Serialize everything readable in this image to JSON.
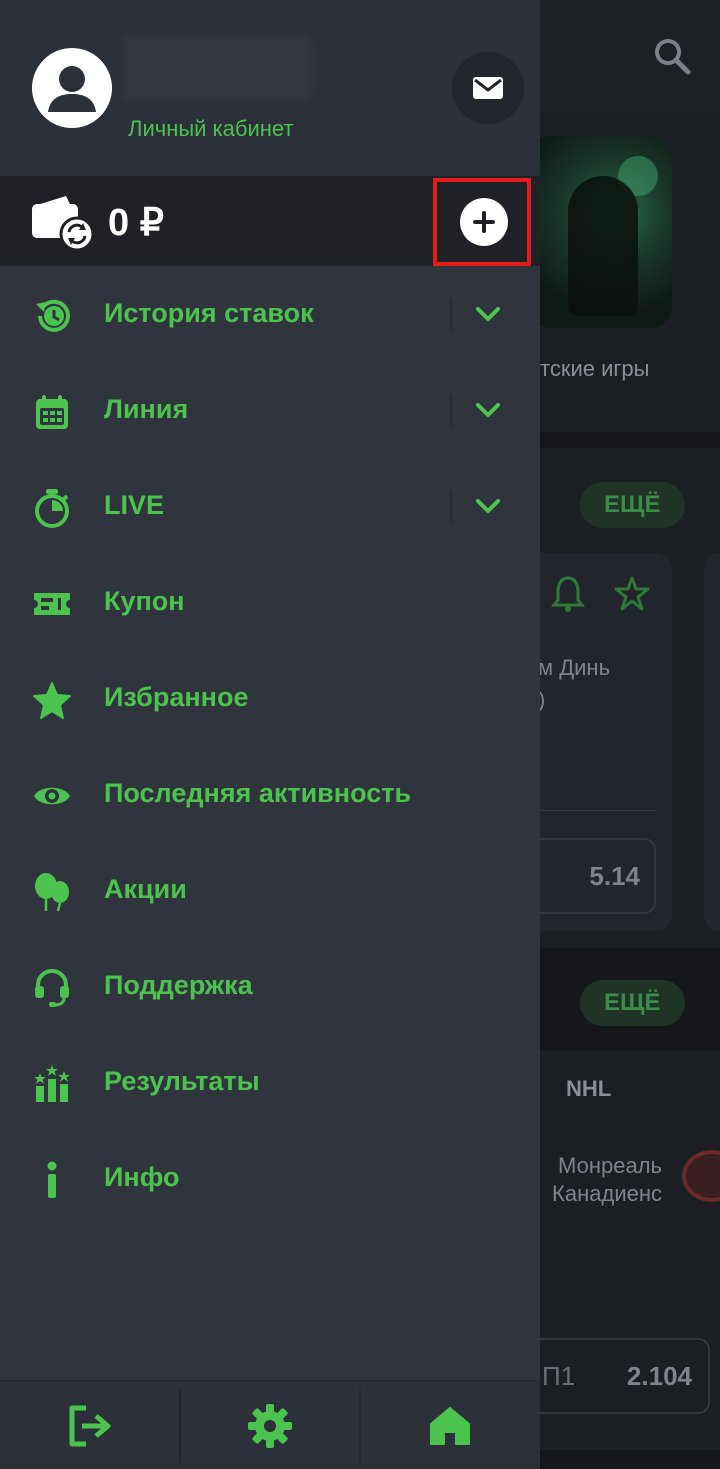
{
  "header": {
    "cabinet_label": "Личный кабинет",
    "avatar_icon": "user-avatar-icon",
    "mail_icon": "envelope-icon"
  },
  "balance": {
    "amount": "0 ₽",
    "wallet_icon": "wallet-refresh-icon",
    "add_icon": "plus-circle-icon"
  },
  "menu": {
    "items": [
      {
        "label": "История ставок",
        "icon": "history-icon",
        "expandable": true
      },
      {
        "label": "Линия",
        "icon": "calendar-icon",
        "expandable": true
      },
      {
        "label": "LIVE",
        "icon": "stopwatch-icon",
        "expandable": true
      },
      {
        "label": "Купон",
        "icon": "ticket-icon",
        "expandable": false
      },
      {
        "label": "Избранное",
        "icon": "star-icon",
        "expandable": false
      },
      {
        "label": "Последняя активность",
        "icon": "eye-icon",
        "expandable": false
      },
      {
        "label": "Акции",
        "icon": "balloons-icon",
        "expandable": false
      },
      {
        "label": "Поддержка",
        "icon": "headset-icon",
        "expandable": false
      },
      {
        "label": "Результаты",
        "icon": "results-icon",
        "expandable": false
      },
      {
        "label": "Инфо",
        "icon": "info-icon",
        "expandable": false
      }
    ]
  },
  "bottom_bar": {
    "items": [
      "logout-icon",
      "gear-icon",
      "home-icon"
    ]
  },
  "background": {
    "game_label": "тские игры",
    "more_label_1": "ЕЩЁ",
    "more_label_2": "ЕЩЁ",
    "team_line_1": "м Динь",
    "team_line_2": ")",
    "odd_1": "5.14",
    "league": "NHL",
    "team2_line_1": "Монреаль",
    "team2_line_2": "Канадиенс",
    "odd_2_label": "П1",
    "odd_2": "2.104"
  },
  "colors": {
    "accent": "#4cc24f",
    "drawer_bg": "#30343c",
    "highlight": "#e21b1b"
  }
}
